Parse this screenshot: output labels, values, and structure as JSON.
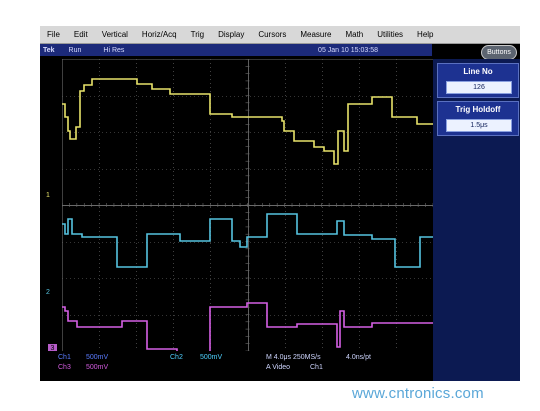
{
  "menu": [
    "File",
    "Edit",
    "Vertical",
    "Horiz/Acq",
    "Trig",
    "Display",
    "Cursors",
    "Measure",
    "Math",
    "Utilities",
    "Help"
  ],
  "status": {
    "brand": "Tek",
    "state": "Run",
    "mode": "Hi Res",
    "datetime": "05 Jan 10 15:03:58"
  },
  "buttons_label": "Buttons",
  "side_panel": {
    "line_no": {
      "title": "Line No",
      "value": "126"
    },
    "trig_holdoff": {
      "title": "Trig Holdoff",
      "value": "1.5μs"
    }
  },
  "channel_markers": {
    "ch1": "1",
    "ch2": "2",
    "ch3": "3"
  },
  "readout": {
    "ch1_label": "Ch1",
    "ch1_scale": "500mV",
    "ch2_label": "Ch2",
    "ch2_scale": "500mV",
    "ch3_label": "Ch3",
    "ch3_scale": "500mV",
    "timebase": "M 4.0μs 250MS/s",
    "resolution": "4.0ns/pt",
    "trigger_source": "A Video",
    "trigger_channel": "Ch1"
  },
  "colors": {
    "ch1": "#e8e36a",
    "ch2": "#56c4e0",
    "ch3": "#d660e6",
    "grid": "#6a6a6a",
    "background": "#000000"
  },
  "watermark": "www.cntronics.com"
}
